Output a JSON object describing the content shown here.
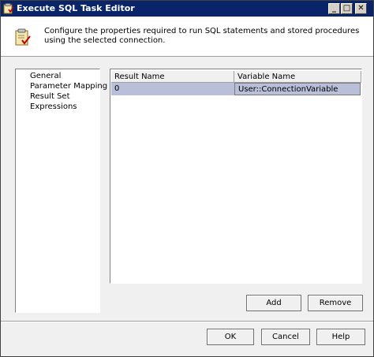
{
  "window": {
    "title": "Execute SQL Task Editor"
  },
  "header": {
    "description": "Configure the properties required to run SQL statements and stored procedures using the selected connection."
  },
  "nav": {
    "items": [
      {
        "label": "General"
      },
      {
        "label": "Parameter Mapping"
      },
      {
        "label": "Result Set"
      },
      {
        "label": "Expressions"
      }
    ],
    "selected": "Result Set"
  },
  "grid": {
    "columns": [
      "Result Name",
      "Variable Name"
    ],
    "rows": [
      {
        "result_name": "0",
        "variable_name": "User::ConnectionVariable"
      }
    ]
  },
  "buttons": {
    "add": "Add",
    "remove": "Remove",
    "ok": "OK",
    "cancel": "Cancel",
    "help": "Help"
  },
  "titlebar_buttons": {
    "minimize": "_",
    "maximize": "□",
    "close": "✕"
  },
  "colors": {
    "titlebar": "#0a246a",
    "selected_row": "#b9bfd9"
  }
}
